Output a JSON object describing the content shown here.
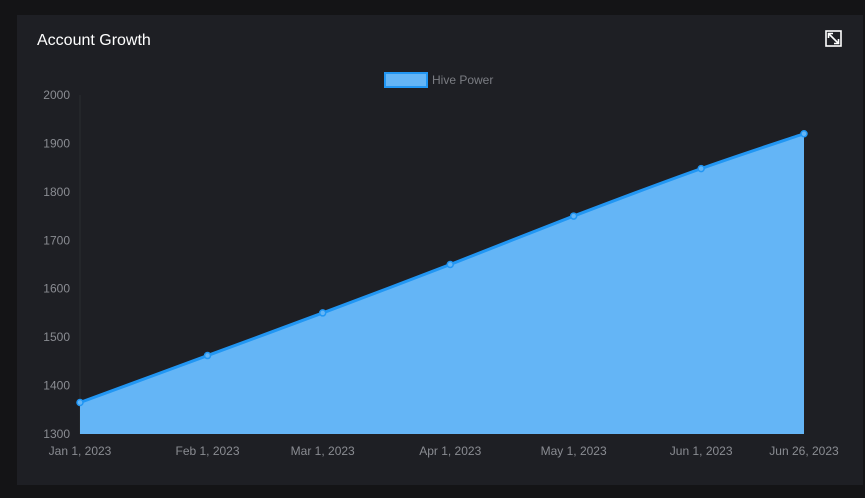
{
  "card": {
    "title": "Account Growth",
    "expand_icon": "expand-icon"
  },
  "colors": {
    "background": "#141416",
    "card": "#1e1f24",
    "area_fill": "#64b5f6",
    "line": "#2196f3",
    "text": "#ffffff",
    "tick_text": "#8a8c92"
  },
  "chart_data": {
    "type": "area",
    "title": "Account Growth",
    "xlabel": "",
    "ylabel": "",
    "x": [
      "Jan 1, 2023",
      "Feb 1, 2023",
      "Mar 1, 2023",
      "Apr 1, 2023",
      "May 1, 2023",
      "Jun 1, 2023",
      "Jun 26, 2023"
    ],
    "series": [
      {
        "name": "Hive Power",
        "values": [
          1365,
          1462,
          1550,
          1650,
          1750,
          1848,
          1920
        ]
      }
    ],
    "yticks": [
      1300,
      1400,
      1500,
      1600,
      1700,
      1800,
      1900,
      2000
    ],
    "ylim": [
      1300,
      2000
    ],
    "grid": false,
    "legend": "top-center"
  }
}
